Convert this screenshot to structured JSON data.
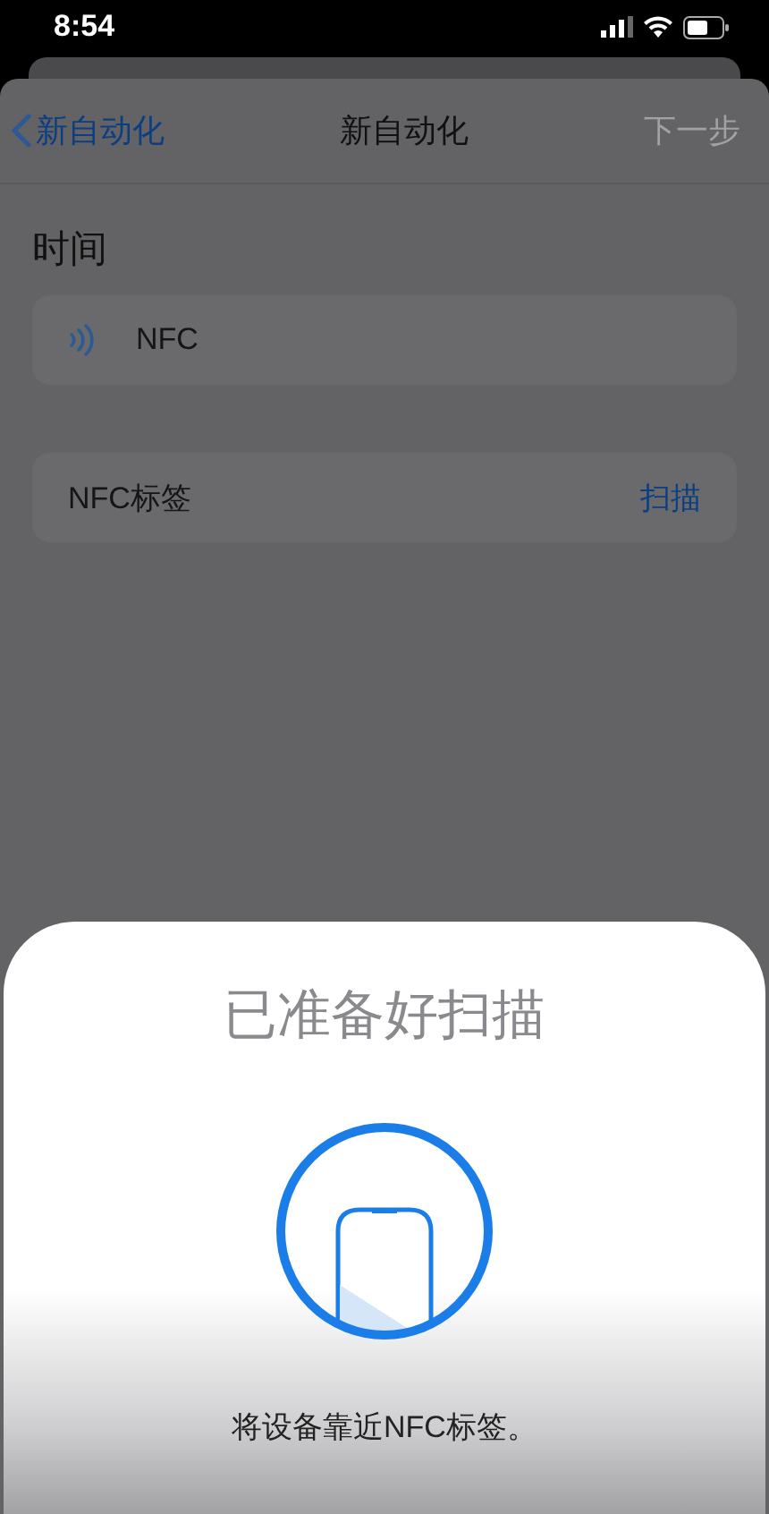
{
  "status_bar": {
    "time": "8:54"
  },
  "nav": {
    "back": "新自动化",
    "title": "新自动化",
    "next": {
      "label": "下一步",
      "disabled": true
    }
  },
  "section_title": "时间",
  "trigger": {
    "label": "NFC"
  },
  "tag_row": {
    "label": "NFC标签",
    "action": "扫描"
  },
  "scan_sheet": {
    "title": "已准备好扫描",
    "message": "将设备靠近NFC标签。"
  }
}
